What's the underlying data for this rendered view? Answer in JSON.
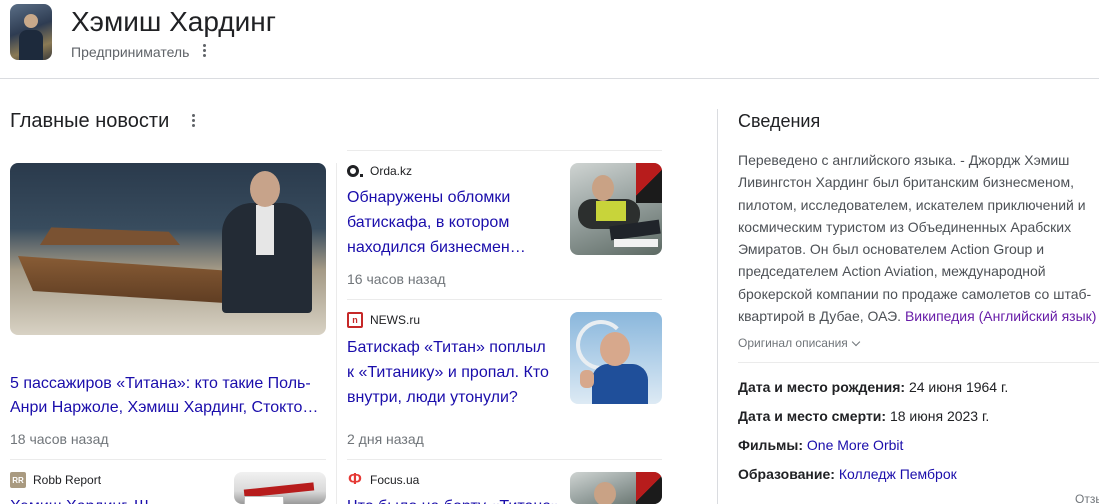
{
  "entity": {
    "name": "Хэмиш Хардинг",
    "subtitle": "Предприниматель"
  },
  "top_stories": {
    "heading": "Главные новости",
    "featured": {
      "title": "5 пассажиров «Титана»: кто такие Поль-Анри Наржоле, Хэмиш Хардинг, Стокто…",
      "time": "18 часов назад"
    },
    "stories": [
      {
        "source": "Orda.kz",
        "title": "Обнаружены обломки батискафа, в котором находился бизнесмен…",
        "time": "16 часов назад"
      },
      {
        "source": "NEWS.ru",
        "title": "Батискаф «Титан» поплыл к «Титанику» и пропал. Кто внутри, люди утонули?",
        "time": "2 дня назад"
      },
      {
        "source": "Robb Report",
        "title": "Хэмиш Хардинг. Ш"
      },
      {
        "source": "Focus.ua",
        "title": "Что было на борту «Титана»"
      }
    ]
  },
  "knowledge_panel": {
    "heading": "Сведения",
    "description": "Переведено с английского языка. - Джордж Хэмиш Ливингстон Хардинг был британским бизнесменом, пилотом, исследователем, искателем приключений и космическим туристом из Объединенных Арабских Эмиратов. Он был основателем Action Group и председателем Action Aviation, международной брокерской компании по продаже самолетов со штаб-квартирой в Дубае, ОАЭ.",
    "source_link": "Википедия (Английский язык)",
    "original_link": "Оригинал описания",
    "facts": [
      {
        "label": "Дата и место рождения:",
        "value": "24 июня 1964 г."
      },
      {
        "label": "Дата и место смерти:",
        "value": "18 июня 2023 г."
      },
      {
        "label": "Фильмы:",
        "value": "One More Orbit"
      },
      {
        "label": "Образование:",
        "value": "Колледж Пемброк"
      }
    ],
    "feedback": "Отзывы"
  },
  "colors": {
    "link": "#1a0dab",
    "visited_link": "#681da8",
    "muted_text": "#70757a",
    "divider": "#dadce0"
  }
}
